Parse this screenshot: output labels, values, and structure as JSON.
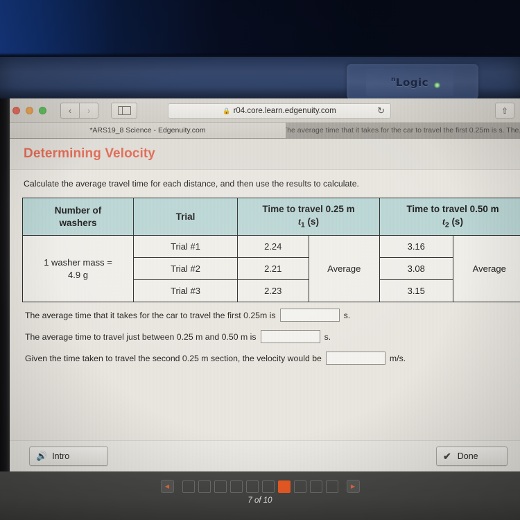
{
  "device": {
    "brand_logo": "nLogic",
    "logo_prefix": "n",
    "logo_main": "Logic"
  },
  "browser": {
    "window_controls": [
      "close",
      "minimize",
      "maximize"
    ],
    "back_label": "‹",
    "forward_label": "›",
    "sidebar_icon": "sidebar-icon",
    "url": "r04.core.learn.edgenuity.com",
    "lock_icon": "🔒",
    "reload_icon": "↻",
    "share_icon": "⇧",
    "tabs": [
      {
        "label": "*ARS19_8 Science - Edgenuity.com",
        "active": true
      },
      {
        "label": "The average time that it takes for the car to travel the first 0.25m is s. The..",
        "active": false
      }
    ]
  },
  "lesson": {
    "title": "Determining Velocity",
    "instruction": "Calculate the average travel time for each distance, and then use the results to calculate.",
    "table": {
      "headers": [
        {
          "line1": "Number of",
          "line2": "washers"
        },
        {
          "line1": "Trial",
          "line2": ""
        },
        {
          "line1": "Time to travel 0.25 m",
          "line2": "t₁ (s)"
        },
        {
          "line1": "Time to travel 0.50 m",
          "line2": "t₂ (s)"
        }
      ],
      "washers_cell": {
        "line1": "1 washer mass =",
        "line2": "4.9 g"
      },
      "rows": [
        {
          "trial": "Trial #1",
          "t1": "2.24",
          "t2": "3.16"
        },
        {
          "trial": "Trial #2",
          "t1": "2.21",
          "t2": "3.08"
        },
        {
          "trial": "Trial #3",
          "t1": "2.23",
          "t2": "3.15"
        }
      ],
      "average_label_t1": "Average",
      "average_label_t2": "Average"
    },
    "questions": [
      {
        "prefix": "The average time that it takes for the car to travel the first 0.25m is",
        "value": "",
        "suffix": "s."
      },
      {
        "prefix": "The average time to travel just between 0.25 m and 0.50 m is",
        "value": "",
        "suffix": "s."
      },
      {
        "prefix": "Given the time taken to travel the second 0.25 m section, the velocity would be",
        "value": "",
        "suffix": "m/s."
      }
    ],
    "buttons": {
      "intro": "Intro",
      "intro_icon": "🔊",
      "done": "Done",
      "done_icon": "✔"
    },
    "pager": {
      "prev_icon": "◀",
      "next_icon": "▶",
      "total_steps": 10,
      "current_step": 7,
      "label": "7 of 10"
    }
  },
  "colors": {
    "title_accent": "#e06a55",
    "table_header_bg": "#b9d5d3",
    "table_body_bg": "#f0eee8",
    "pager_active": "#ec5b24",
    "page_bg": "#e8e5df"
  }
}
